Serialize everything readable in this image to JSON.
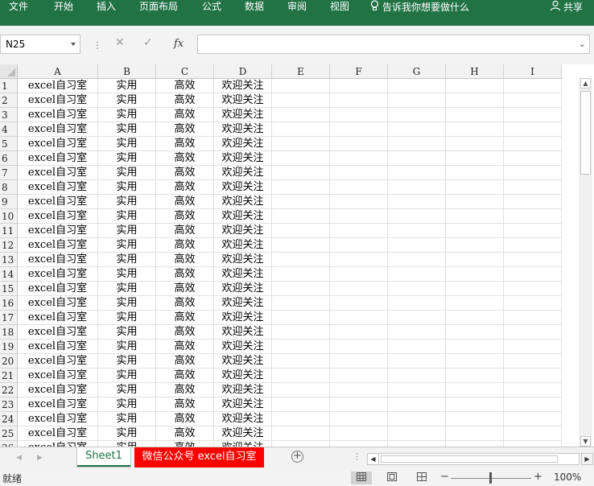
{
  "ribbon": {
    "tabs": [
      "文件",
      "开始",
      "插入",
      "页面布局",
      "公式",
      "数据",
      "审阅",
      "视图"
    ],
    "tell_me": "告诉我你想要做什么",
    "share": "共享"
  },
  "formula_bar": {
    "name_box": "N25",
    "fx_label": "fx",
    "formula": ""
  },
  "grid": {
    "columns": [
      "A",
      "B",
      "C",
      "D",
      "E",
      "F",
      "G",
      "H",
      "I"
    ],
    "row_numbers": [
      "1",
      "2",
      "3",
      "4",
      "5",
      "6",
      "7",
      "8",
      "9",
      "10",
      "11",
      "12",
      "13",
      "14",
      "15",
      "16",
      "17",
      "18",
      "19",
      "20",
      "21",
      "22",
      "23",
      "24",
      "25",
      "26"
    ],
    "row_values": [
      "excel自习室",
      "实用",
      "高效",
      "欢迎关注"
    ]
  },
  "sheets": {
    "tabs": [
      "Sheet1",
      "微信公众号 excel自习室"
    ],
    "active_color": "#217346",
    "highlight_color": "#ff0000"
  },
  "status": {
    "ready": "就绪",
    "zoom": "100%",
    "zoom_minus": "−",
    "zoom_plus": "+"
  },
  "colors": {
    "ribbon": "#217346"
  }
}
